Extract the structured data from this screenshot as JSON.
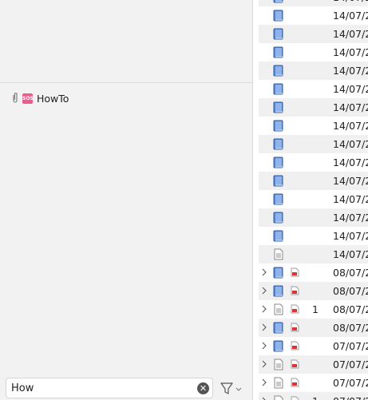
{
  "sidebar": {
    "tag": {
      "icon": "clip-icon",
      "emoji": "SOS",
      "label": "HowTo"
    }
  },
  "search": {
    "value": "How",
    "placeholder": ""
  },
  "rows": [
    {
      "chev": false,
      "type": "book",
      "pdf": false,
      "count": "",
      "date": "14/07/2"
    },
    {
      "chev": false,
      "type": "book",
      "pdf": false,
      "count": "",
      "date": "14/07/2"
    },
    {
      "chev": false,
      "type": "book",
      "pdf": false,
      "count": "",
      "date": "14/07/2"
    },
    {
      "chev": false,
      "type": "book",
      "pdf": false,
      "count": "",
      "date": "14/07/2"
    },
    {
      "chev": false,
      "type": "book",
      "pdf": false,
      "count": "",
      "date": "14/07/2"
    },
    {
      "chev": false,
      "type": "book",
      "pdf": false,
      "count": "",
      "date": "14/07/2"
    },
    {
      "chev": false,
      "type": "book",
      "pdf": false,
      "count": "",
      "date": "14/07/2"
    },
    {
      "chev": false,
      "type": "book",
      "pdf": false,
      "count": "",
      "date": "14/07/2"
    },
    {
      "chev": false,
      "type": "book",
      "pdf": false,
      "count": "",
      "date": "14/07/2"
    },
    {
      "chev": false,
      "type": "book",
      "pdf": false,
      "count": "",
      "date": "14/07/2"
    },
    {
      "chev": false,
      "type": "book",
      "pdf": false,
      "count": "",
      "date": "14/07/2"
    },
    {
      "chev": false,
      "type": "book",
      "pdf": false,
      "count": "",
      "date": "14/07/2"
    },
    {
      "chev": false,
      "type": "book",
      "pdf": false,
      "count": "",
      "date": "14/07/2"
    },
    {
      "chev": false,
      "type": "book",
      "pdf": false,
      "count": "",
      "date": "14/07/2"
    },
    {
      "chev": false,
      "type": "doc",
      "pdf": false,
      "count": "",
      "date": "14/07/2"
    },
    {
      "chev": true,
      "type": "book",
      "pdf": true,
      "count": "",
      "date": "08/07/2"
    },
    {
      "chev": true,
      "type": "book",
      "pdf": true,
      "count": "",
      "date": "08/07/2"
    },
    {
      "chev": true,
      "type": "doc",
      "pdf": true,
      "count": "1",
      "date": "08/07/2"
    },
    {
      "chev": true,
      "type": "book",
      "pdf": true,
      "count": "",
      "date": "08/07/2"
    },
    {
      "chev": true,
      "type": "book",
      "pdf": true,
      "count": "",
      "date": "07/07/2"
    },
    {
      "chev": true,
      "type": "doc",
      "pdf": true,
      "count": "",
      "date": "07/07/2"
    },
    {
      "chev": true,
      "type": "doc",
      "pdf": true,
      "count": "",
      "date": "07/07/2"
    },
    {
      "chev": true,
      "type": "doc",
      "pdf": true,
      "count": "1",
      "date": "07/07/2"
    }
  ]
}
